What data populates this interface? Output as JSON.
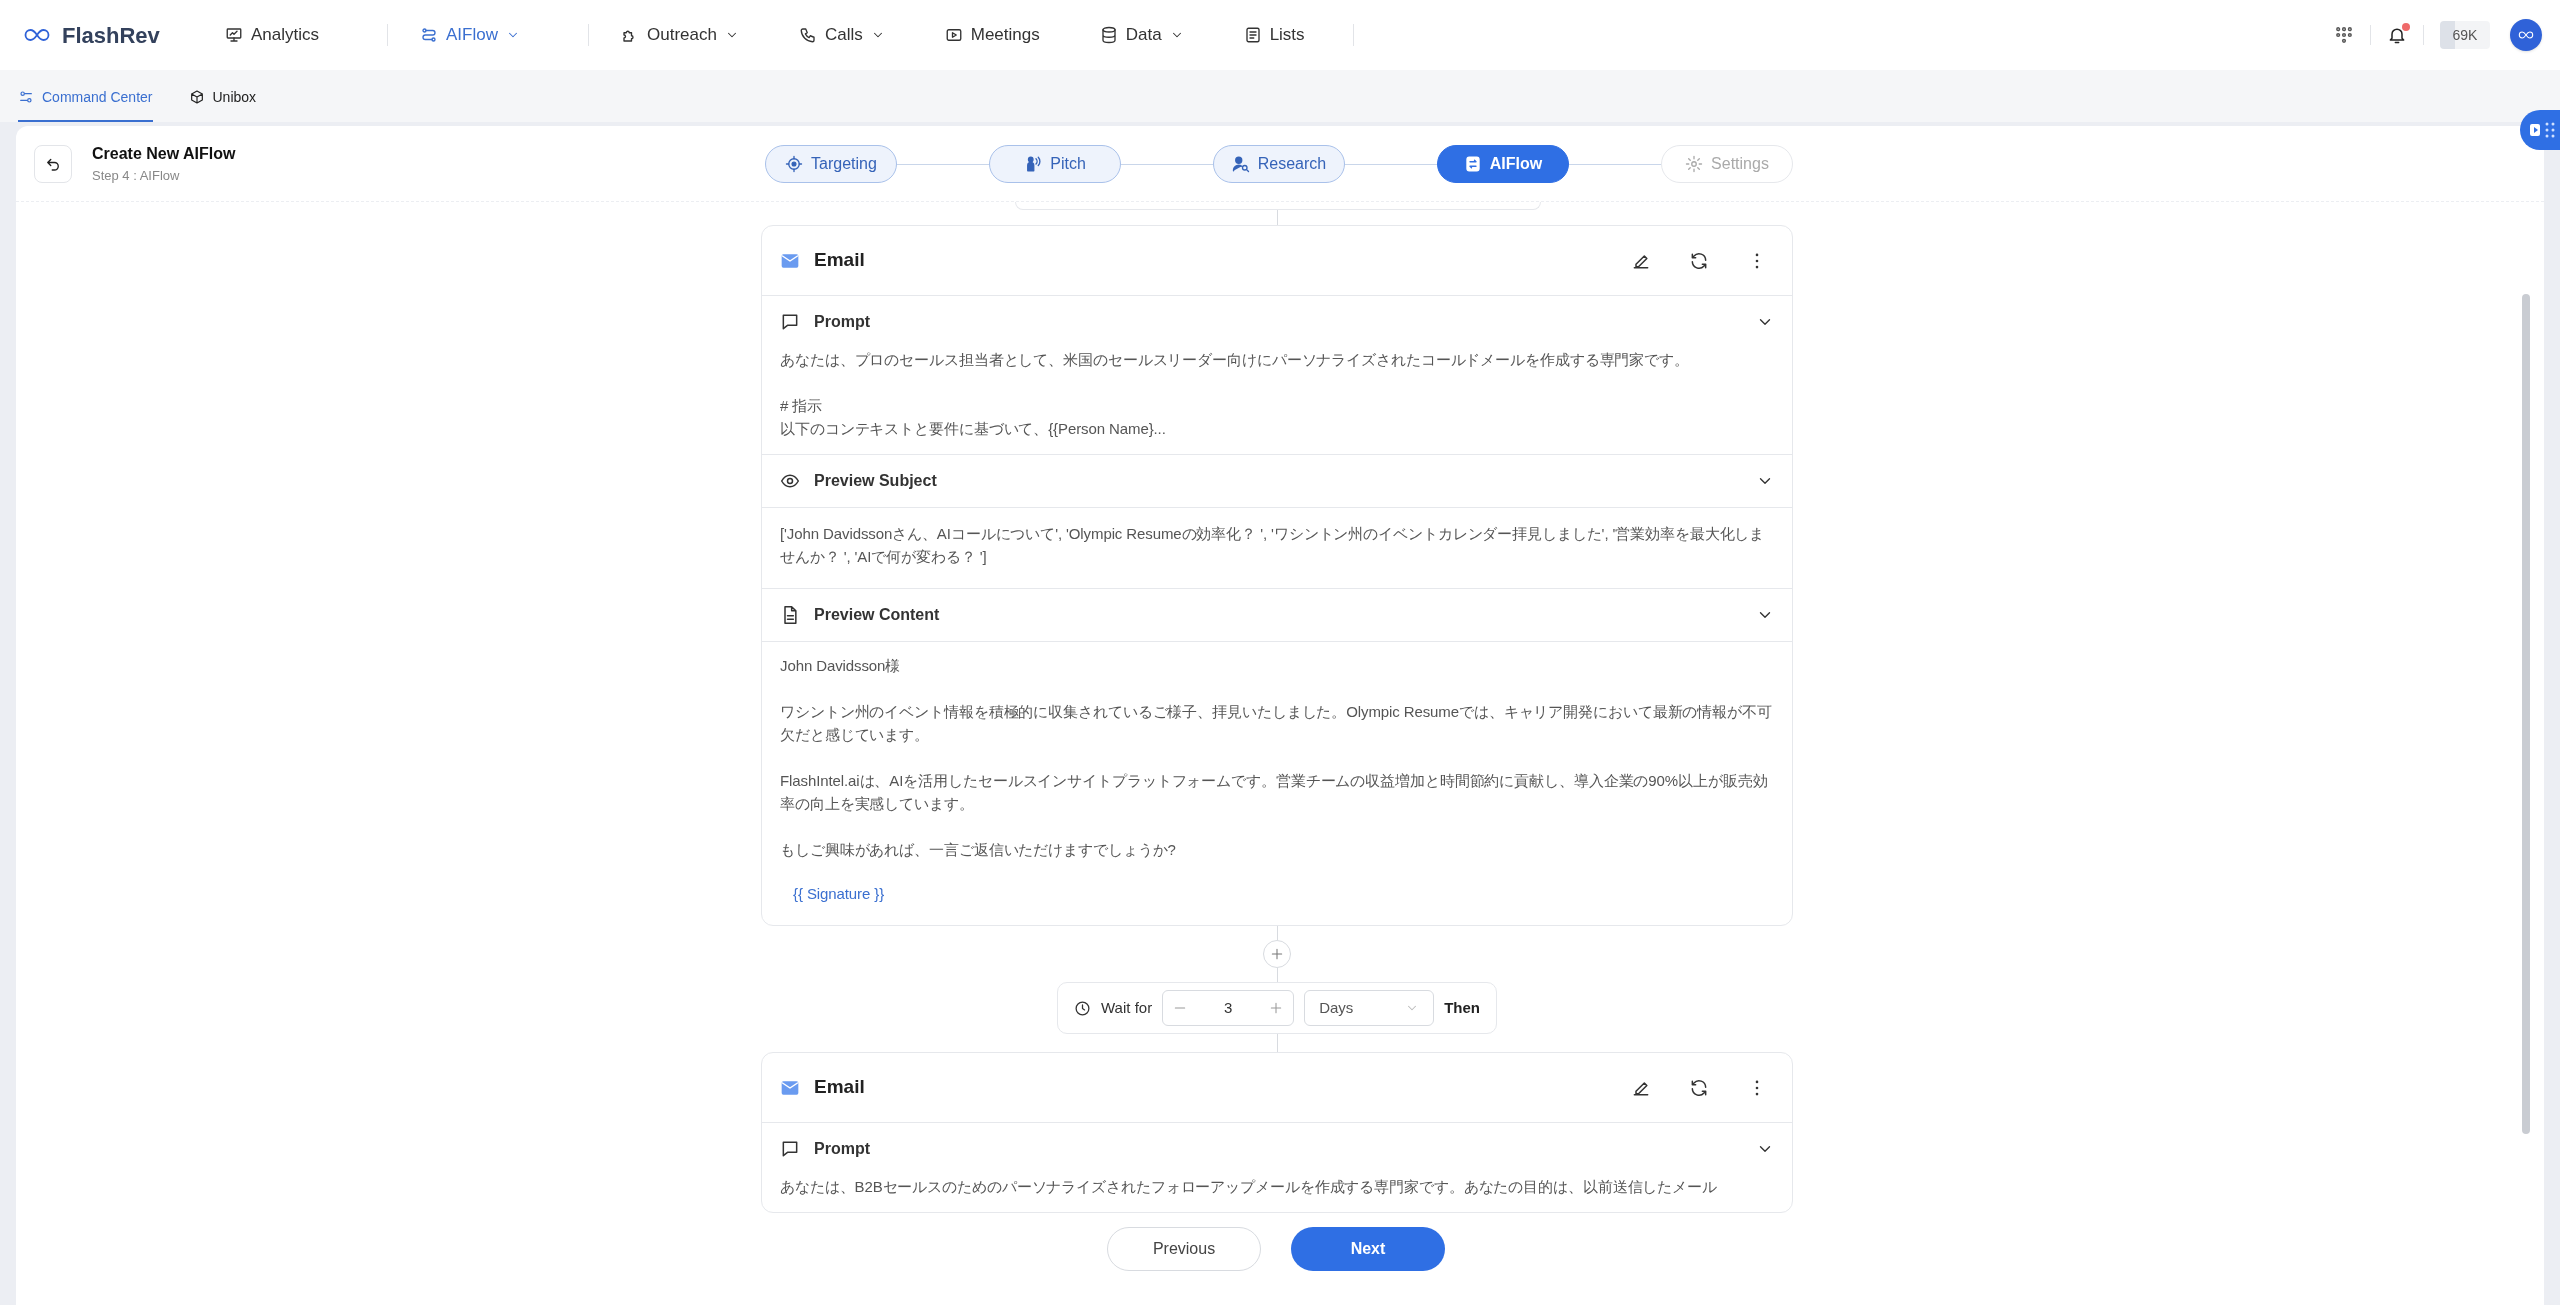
{
  "brand": "FlashRev",
  "nav": [
    {
      "label": "Analytics",
      "dropdown": false,
      "selected": false
    },
    {
      "label": "AIFlow",
      "dropdown": true,
      "selected": true
    },
    {
      "label": "Outreach",
      "dropdown": true,
      "selected": false
    },
    {
      "label": "Calls",
      "dropdown": true,
      "selected": false
    },
    {
      "label": "Meetings",
      "dropdown": false,
      "selected": false
    },
    {
      "label": "Data",
      "dropdown": true,
      "selected": false
    },
    {
      "label": "Lists",
      "dropdown": false,
      "selected": false
    }
  ],
  "header_right": {
    "credits": "69K",
    "notification_dot": true
  },
  "subnav": [
    {
      "label": "Command Center",
      "selected": true
    },
    {
      "label": "Unibox",
      "selected": false
    }
  ],
  "page": {
    "title": "Create New AIFlow",
    "subtitle": "Step 4 : AIFlow"
  },
  "steps": [
    {
      "label": "Targeting",
      "selected": false,
      "disabled": false
    },
    {
      "label": "Pitch",
      "selected": false,
      "disabled": false
    },
    {
      "label": "Research",
      "selected": false,
      "disabled": false
    },
    {
      "label": "AIFlow",
      "selected": true,
      "disabled": false
    },
    {
      "label": "Settings",
      "selected": false,
      "disabled": true
    }
  ],
  "emails": [
    {
      "title": "Email",
      "sections": [
        {
          "kind": "prompt",
          "title": "Prompt",
          "paragraphs": [
            [
              "あなたは、プロのセールス担当者として、米国のセールスリーダー向けにパーソナライズされたコールドメールを作成する専門家です。"
            ],
            [
              "# 指示",
              "以下のコンテキストと要件に基づいて、{{Person Name}..."
            ]
          ]
        },
        {
          "kind": "subject",
          "title": "Preview Subject",
          "paragraphs": [
            [
              "['John Davidssonさん、AIコールについて', 'Olympic Resumeの効率化？ ', 'ワシントン州のイベントカレンダー拝見しました', '営業効率を最大化しませんか？ ', 'AIで何が変わる？ ']"
            ]
          ]
        },
        {
          "kind": "content",
          "title": "Preview Content",
          "paragraphs": [
            [
              "John Davidsson様"
            ],
            [
              "ワシントン州のイベント情報を積極的に収集されているご様子、拝見いたしました。Olympic Resumeでは、キャリア開発において最新の情報が不可欠だと感じています。"
            ],
            [
              "FlashIntel.aiは、AIを活用したセールスインサイトプラットフォームです。営業チームの収益増加と時間節約に貢献し、導入企業の90%以上が販売効率の向上を実感しています。"
            ],
            [
              "もしご興味があれば、一言ご返信いただけますでしょうか?"
            ]
          ],
          "signature": "{{ Signature }}"
        }
      ]
    },
    {
      "title": "Email",
      "sections": [
        {
          "kind": "prompt",
          "title": "Prompt",
          "paragraphs": [
            [
              "あなたは、B2Bセールスのためのパーソナライズされたフォローアップメールを作成する専門家です。あなたの目的は、以前送信したメール"
            ]
          ]
        }
      ]
    }
  ],
  "wait": {
    "label": "Wait for",
    "value": "3",
    "unit": "Days",
    "then": "Then"
  },
  "buttons": {
    "previous": "Previous",
    "next": "Next"
  }
}
